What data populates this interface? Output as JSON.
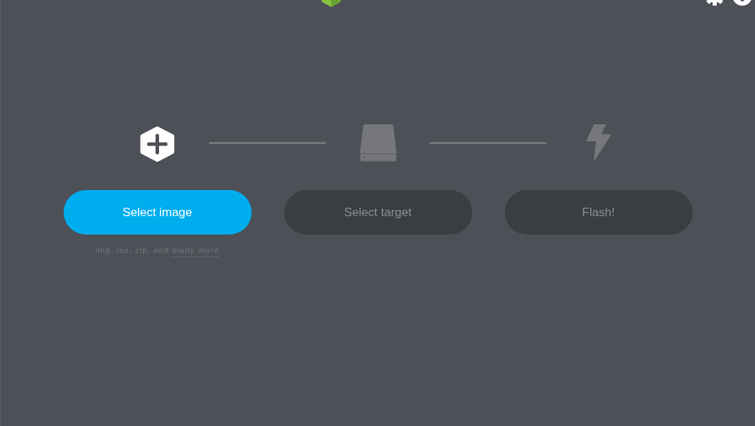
{
  "steps": [
    {
      "kind": "image",
      "disabled": false,
      "button": "Select image",
      "hint": "img, iso, zip, and",
      "hint_link": "many more"
    },
    {
      "kind": "drive",
      "disabled": true,
      "button": "Select target"
    },
    {
      "kind": "flash",
      "disabled": true,
      "button": "Flash!"
    }
  ]
}
